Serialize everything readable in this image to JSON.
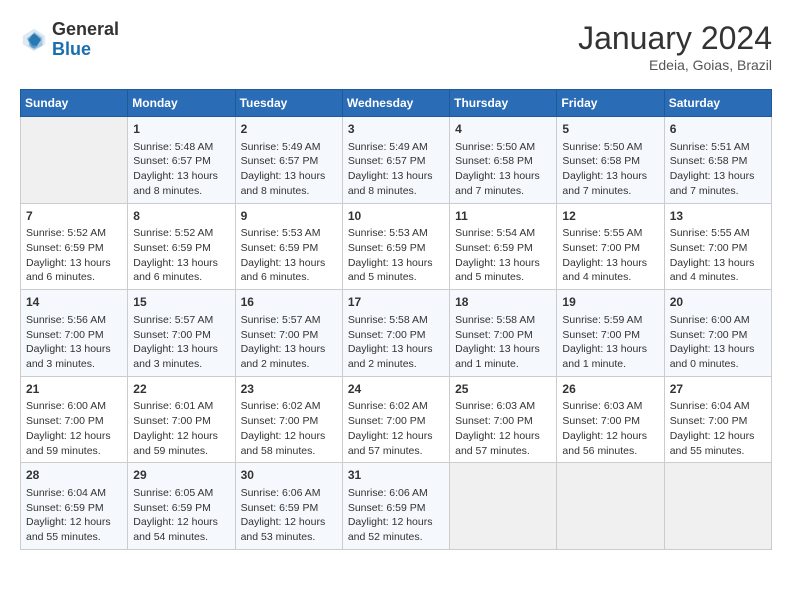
{
  "header": {
    "logo": {
      "general": "General",
      "blue": "Blue"
    },
    "title": "January 2024",
    "subtitle": "Edeia, Goias, Brazil"
  },
  "days_of_week": [
    "Sunday",
    "Monday",
    "Tuesday",
    "Wednesday",
    "Thursday",
    "Friday",
    "Saturday"
  ],
  "weeks": [
    [
      {
        "day": "",
        "content": ""
      },
      {
        "day": "1",
        "content": "Sunrise: 5:48 AM\nSunset: 6:57 PM\nDaylight: 13 hours and 8 minutes."
      },
      {
        "day": "2",
        "content": "Sunrise: 5:49 AM\nSunset: 6:57 PM\nDaylight: 13 hours and 8 minutes."
      },
      {
        "day": "3",
        "content": "Sunrise: 5:49 AM\nSunset: 6:57 PM\nDaylight: 13 hours and 8 minutes."
      },
      {
        "day": "4",
        "content": "Sunrise: 5:50 AM\nSunset: 6:58 PM\nDaylight: 13 hours and 7 minutes."
      },
      {
        "day": "5",
        "content": "Sunrise: 5:50 AM\nSunset: 6:58 PM\nDaylight: 13 hours and 7 minutes."
      },
      {
        "day": "6",
        "content": "Sunrise: 5:51 AM\nSunset: 6:58 PM\nDaylight: 13 hours and 7 minutes."
      }
    ],
    [
      {
        "day": "7",
        "content": "Sunrise: 5:52 AM\nSunset: 6:59 PM\nDaylight: 13 hours and 6 minutes."
      },
      {
        "day": "8",
        "content": "Sunrise: 5:52 AM\nSunset: 6:59 PM\nDaylight: 13 hours and 6 minutes."
      },
      {
        "day": "9",
        "content": "Sunrise: 5:53 AM\nSunset: 6:59 PM\nDaylight: 13 hours and 6 minutes."
      },
      {
        "day": "10",
        "content": "Sunrise: 5:53 AM\nSunset: 6:59 PM\nDaylight: 13 hours and 5 minutes."
      },
      {
        "day": "11",
        "content": "Sunrise: 5:54 AM\nSunset: 6:59 PM\nDaylight: 13 hours and 5 minutes."
      },
      {
        "day": "12",
        "content": "Sunrise: 5:55 AM\nSunset: 7:00 PM\nDaylight: 13 hours and 4 minutes."
      },
      {
        "day": "13",
        "content": "Sunrise: 5:55 AM\nSunset: 7:00 PM\nDaylight: 13 hours and 4 minutes."
      }
    ],
    [
      {
        "day": "14",
        "content": "Sunrise: 5:56 AM\nSunset: 7:00 PM\nDaylight: 13 hours and 3 minutes."
      },
      {
        "day": "15",
        "content": "Sunrise: 5:57 AM\nSunset: 7:00 PM\nDaylight: 13 hours and 3 minutes."
      },
      {
        "day": "16",
        "content": "Sunrise: 5:57 AM\nSunset: 7:00 PM\nDaylight: 13 hours and 2 minutes."
      },
      {
        "day": "17",
        "content": "Sunrise: 5:58 AM\nSunset: 7:00 PM\nDaylight: 13 hours and 2 minutes."
      },
      {
        "day": "18",
        "content": "Sunrise: 5:58 AM\nSunset: 7:00 PM\nDaylight: 13 hours and 1 minute."
      },
      {
        "day": "19",
        "content": "Sunrise: 5:59 AM\nSunset: 7:00 PM\nDaylight: 13 hours and 1 minute."
      },
      {
        "day": "20",
        "content": "Sunrise: 6:00 AM\nSunset: 7:00 PM\nDaylight: 13 hours and 0 minutes."
      }
    ],
    [
      {
        "day": "21",
        "content": "Sunrise: 6:00 AM\nSunset: 7:00 PM\nDaylight: 12 hours and 59 minutes."
      },
      {
        "day": "22",
        "content": "Sunrise: 6:01 AM\nSunset: 7:00 PM\nDaylight: 12 hours and 59 minutes."
      },
      {
        "day": "23",
        "content": "Sunrise: 6:02 AM\nSunset: 7:00 PM\nDaylight: 12 hours and 58 minutes."
      },
      {
        "day": "24",
        "content": "Sunrise: 6:02 AM\nSunset: 7:00 PM\nDaylight: 12 hours and 57 minutes."
      },
      {
        "day": "25",
        "content": "Sunrise: 6:03 AM\nSunset: 7:00 PM\nDaylight: 12 hours and 57 minutes."
      },
      {
        "day": "26",
        "content": "Sunrise: 6:03 AM\nSunset: 7:00 PM\nDaylight: 12 hours and 56 minutes."
      },
      {
        "day": "27",
        "content": "Sunrise: 6:04 AM\nSunset: 7:00 PM\nDaylight: 12 hours and 55 minutes."
      }
    ],
    [
      {
        "day": "28",
        "content": "Sunrise: 6:04 AM\nSunset: 6:59 PM\nDaylight: 12 hours and 55 minutes."
      },
      {
        "day": "29",
        "content": "Sunrise: 6:05 AM\nSunset: 6:59 PM\nDaylight: 12 hours and 54 minutes."
      },
      {
        "day": "30",
        "content": "Sunrise: 6:06 AM\nSunset: 6:59 PM\nDaylight: 12 hours and 53 minutes."
      },
      {
        "day": "31",
        "content": "Sunrise: 6:06 AM\nSunset: 6:59 PM\nDaylight: 12 hours and 52 minutes."
      },
      {
        "day": "",
        "content": ""
      },
      {
        "day": "",
        "content": ""
      },
      {
        "day": "",
        "content": ""
      }
    ]
  ]
}
